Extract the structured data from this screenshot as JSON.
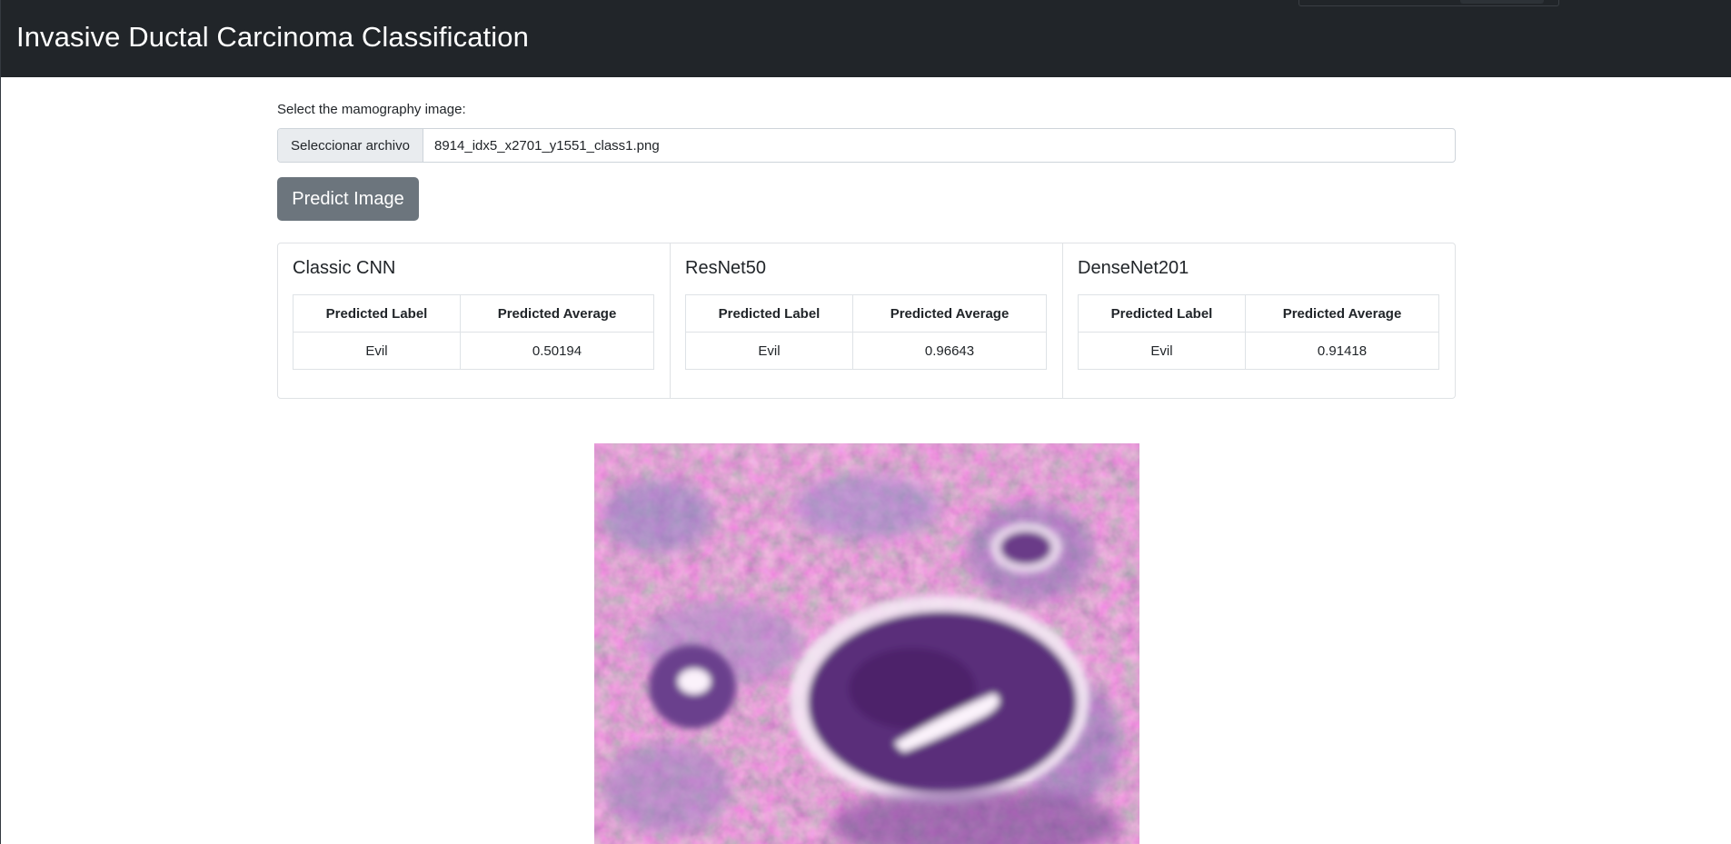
{
  "header": {
    "title": "Invasive Ductal Carcinoma Classification"
  },
  "form": {
    "label": "Select the mamography image:",
    "file_button": "Seleccionar archivo",
    "file_name": "8914_idx5_x2701_y1551_class1.png",
    "predict_button": "Predict Image"
  },
  "table_headers": {
    "label": "Predicted Label",
    "average": "Predicted Average"
  },
  "models": [
    {
      "name": "Classic CNN",
      "label": "Evil",
      "average": "0.50194"
    },
    {
      "name": "ResNet50",
      "label": "Evil",
      "average": "0.96643"
    },
    {
      "name": "DenseNet201",
      "label": "Evil",
      "average": "0.91418"
    }
  ],
  "colors": {
    "navbar": "#212529",
    "button": "#6c757d",
    "tissue_base": "#c06ea6",
    "tissue_dark": "#5a2d7a"
  }
}
